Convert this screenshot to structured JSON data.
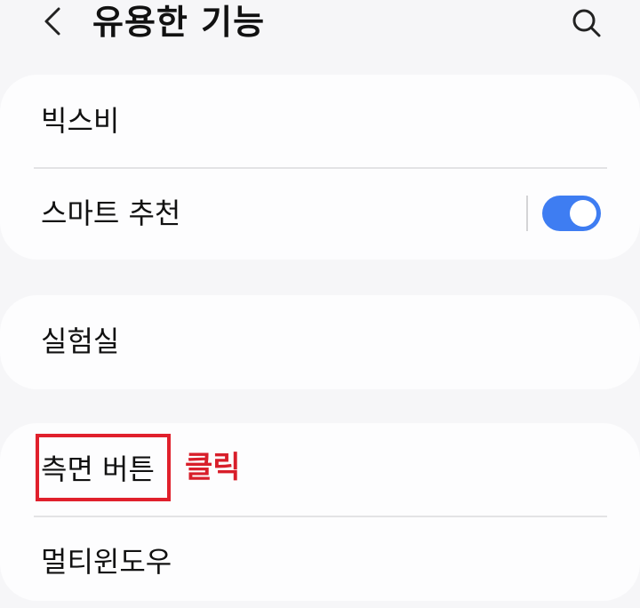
{
  "header": {
    "title": "유용한 기능",
    "back_icon": "chevron-left-icon",
    "search_icon": "search-icon"
  },
  "sections": [
    {
      "items": [
        {
          "label": "빅스비"
        },
        {
          "label": "스마트 추천",
          "toggle": {
            "on": true,
            "color": "#3e7df2"
          }
        }
      ]
    },
    {
      "items": [
        {
          "label": "실험실"
        }
      ]
    },
    {
      "items": [
        {
          "label": "측면 버튼"
        },
        {
          "label": "멀티윈도우"
        }
      ]
    }
  ],
  "annotation": {
    "text": "클릭",
    "color": "#d81e2a",
    "target": "측면 버튼"
  }
}
